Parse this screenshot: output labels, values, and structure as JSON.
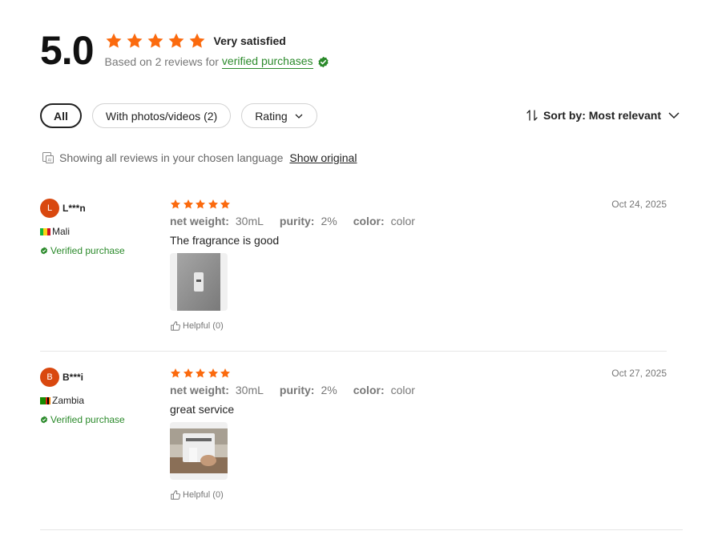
{
  "colors": {
    "star": "#fb6a0e",
    "verified_green": "#2b8a2b",
    "avatar_bg": "#d9480f"
  },
  "summary": {
    "score": "5.0",
    "rating_stars": 5,
    "rating_text": "Very satisfied",
    "based_on": "Based on 2 reviews for",
    "verified_link": "verified purchases"
  },
  "filters": {
    "all": "All",
    "photos": "With photos/videos (2)",
    "rating": "Rating"
  },
  "sort": {
    "label": "Sort by: Most relevant"
  },
  "language": {
    "notice": "Showing all reviews in your chosen language",
    "show_original": "Show original"
  },
  "reviews": [
    {
      "initial": "L",
      "name": "L***n",
      "country": "Mali",
      "verified": "Verified purchase",
      "stars": 5,
      "date": "Oct 24, 2025",
      "specs": [
        {
          "key": "net weight:",
          "value": "30mL"
        },
        {
          "key": "purity:",
          "value": "2%"
        },
        {
          "key": "color:",
          "value": "color"
        }
      ],
      "comment": "The fragrance is good",
      "helpful": "Helpful (0)"
    },
    {
      "initial": "B",
      "name": "B***i",
      "country": "Zambia",
      "verified": "Verified purchase",
      "stars": 5,
      "date": "Oct 27, 2025",
      "specs": [
        {
          "key": "net weight:",
          "value": "30mL"
        },
        {
          "key": "purity:",
          "value": "2%"
        },
        {
          "key": "color:",
          "value": "color"
        }
      ],
      "comment": "great service",
      "helpful": "Helpful (0)"
    }
  ]
}
